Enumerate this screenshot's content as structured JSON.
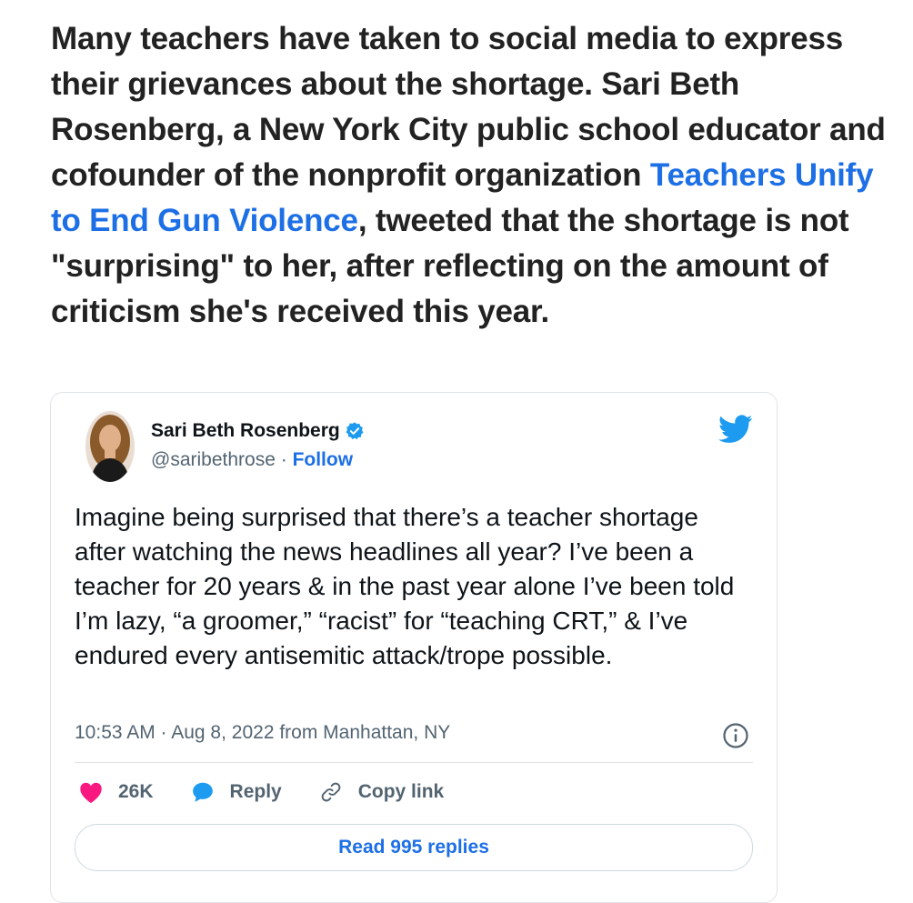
{
  "article": {
    "text_before_link": "Many teachers have taken to social media to express their grievances about the shortage. Sari Beth Rosenberg, a New York City public school educator and cofounder of the nonprofit organization ",
    "link_text": "Teachers Unify to End Gun Violence",
    "text_after_link": ", tweeted that the shortage is not \"surprising\" to her, after reflecting on the amount of criticism she's received this year."
  },
  "tweet": {
    "author_name": "Sari Beth Rosenberg",
    "handle": "@saribethrose",
    "separator": " · ",
    "follow_label": "Follow",
    "body": "Imagine being surprised that there’s a teacher shortage after watching the news headlines all year? I’ve been a teacher for 20 years & in the past year alone I’ve been told I’m lazy, “a groomer,” “racist” for “teaching CRT,” & I’ve endured every antisemitic attack/trope possible.",
    "timestamp": "10:53 AM · Aug 8, 2022 from Manhattan, NY",
    "likes_count": "26K",
    "reply_label": "Reply",
    "copy_link_label": "Copy link",
    "read_replies_label": "Read 995 replies"
  },
  "icons": [
    "verified-badge-icon",
    "twitter-bird-icon",
    "info-icon",
    "heart-icon",
    "reply-bubble-icon",
    "link-icon"
  ],
  "colors": {
    "link_blue": "#1d6fe6",
    "twitter_blue": "#1d9bf0",
    "heart_pink": "#f91880",
    "text_dark": "#222222",
    "text_gray": "#536471",
    "border": "#dfe3e7"
  }
}
